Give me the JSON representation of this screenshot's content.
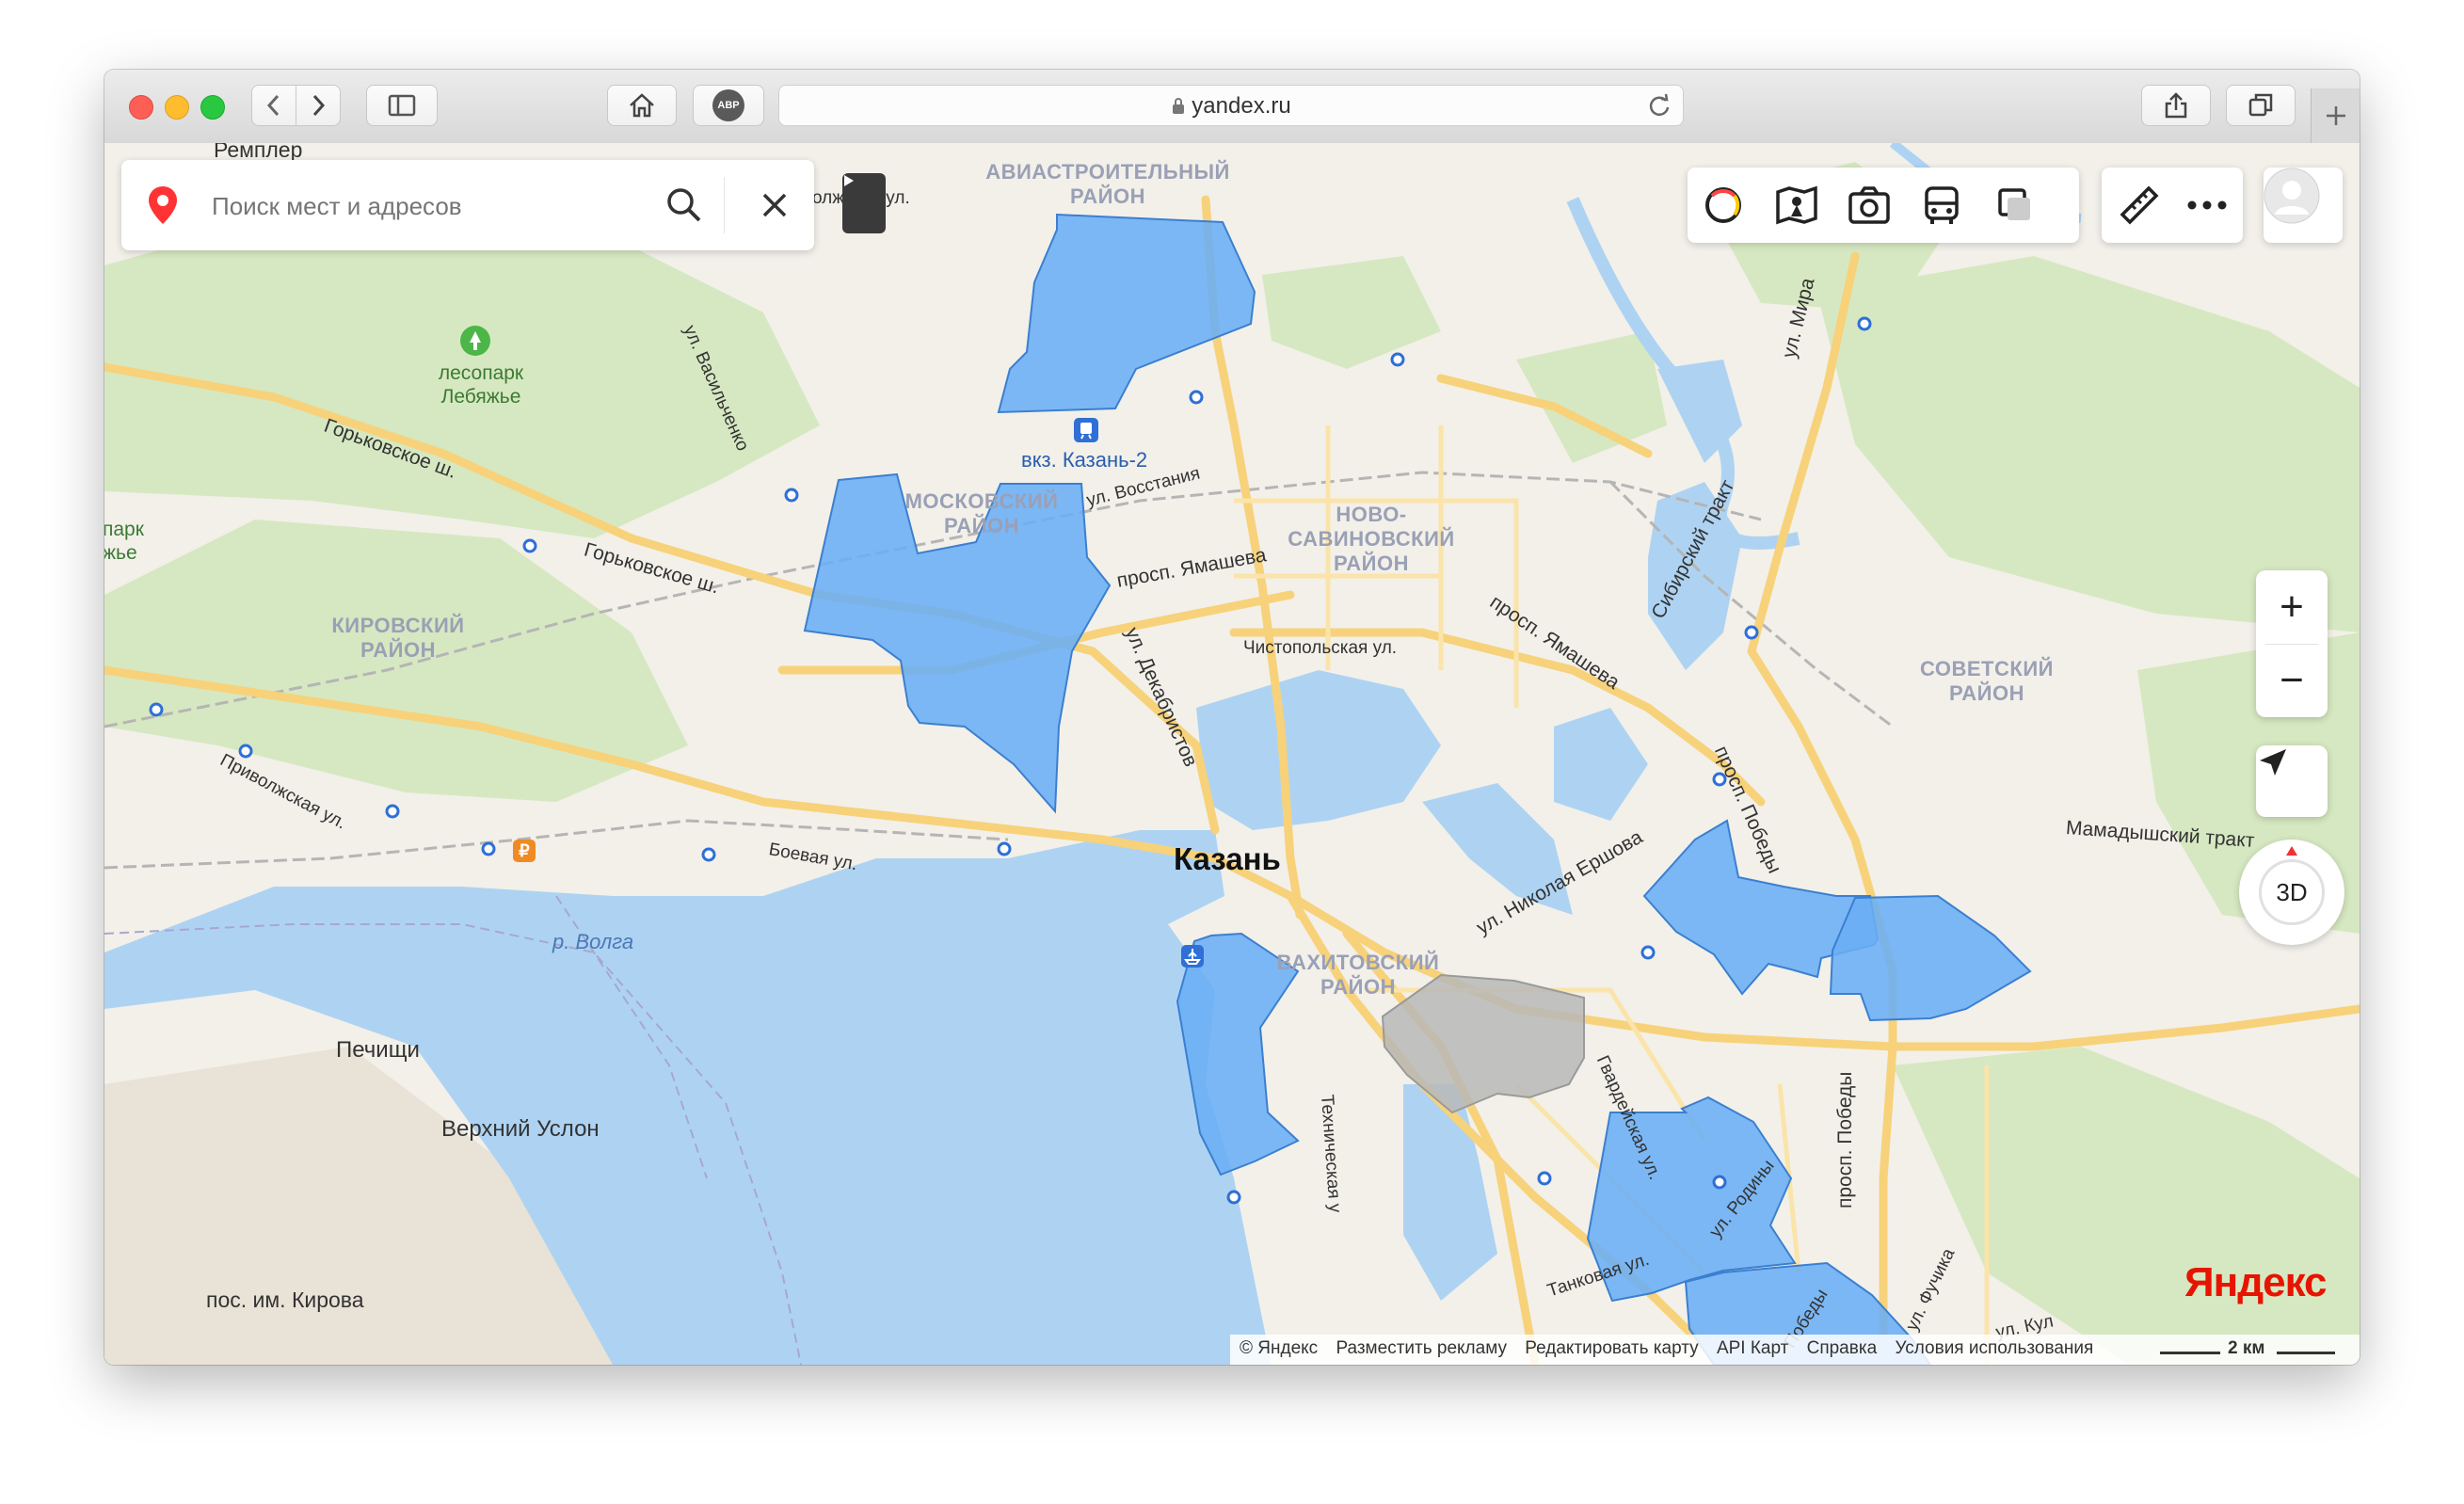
{
  "browser": {
    "url": "yandex.ru",
    "abp_label": "ABP"
  },
  "search": {
    "placeholder": "Поиск мест и адресов"
  },
  "city": "Казань",
  "districts": [
    "АВИАСТРОИТЕЛЬНЫЙ\nРАЙОН",
    "МОСКОВСКИЙ\nРАЙОН",
    "НОВО-\nСАВИНОВСКИЙ\nРАЙОН",
    "КИРОВСКИЙ\nРАЙОН",
    "СОВЕТСКИЙ\nРАЙОН",
    "ВАХИТОВСКИЙ\nРАЙОН"
  ],
  "places": {
    "remplier": "Ремплер",
    "lesopark": "лесопарк\nЛебяжье",
    "park_partial": "парк\nжье",
    "station": "вкз. Казань-2",
    "volga": "р. Волга",
    "pechishchi": "Печищи",
    "verkhny_uslon": "Верхний Услон",
    "kirova": "пос. им. Кирова"
  },
  "streets": [
    "олжская ул.",
    "ул. Васильченко",
    "Горьковское ш.",
    "Горьковское ш.",
    "ул. Восстания",
    "просп. Ямашева",
    "просп. Ямашева",
    "ул. Декабристов",
    "Чистопольская ул.",
    "Сибирский тракт",
    "ул. Мира",
    "Приволжская ул.",
    "Боевая ул.",
    "ул. Николая Ершова",
    "просп. Победы",
    "Мамадышский тракт",
    "просп. Победы",
    "Гвардейская ул.",
    "ул. Родины",
    "Танковая ул.",
    "Победы",
    "Техническая у",
    "ул. Фучика",
    "ул. Кул"
  ],
  "controls": {
    "zoom_in": "+",
    "zoom_out": "−",
    "btn_3d": "3D"
  },
  "footer": {
    "copyright": "© Яндекс",
    "ad": "Разместить рекламу",
    "edit": "Редактировать карту",
    "api": "API Карт",
    "help": "Справка",
    "terms": "Условия использования",
    "scale": "2 км"
  },
  "logo": "Яндекс",
  "colors": {
    "zone_blue": "#6aaef5",
    "zone_gray": "#b9b9b9",
    "water": "#aed3f2",
    "forest": "#d7e9c2",
    "road": "#f7d27a",
    "district_label": "#9aa0b5",
    "logo_red": "#e61400"
  },
  "icons": [
    "location-pin-icon",
    "search-icon",
    "close-icon",
    "play-icon",
    "traffic-layer-icon",
    "panorama-icon",
    "photo-icon",
    "transit-icon",
    "layers-icon",
    "ruler-icon",
    "more-icon",
    "user-avatar-icon",
    "zoom-in-icon",
    "zoom-out-icon",
    "geolocation-icon",
    "train-station-icon",
    "river-port-icon",
    "metro-station-icon",
    "park-icon"
  ]
}
